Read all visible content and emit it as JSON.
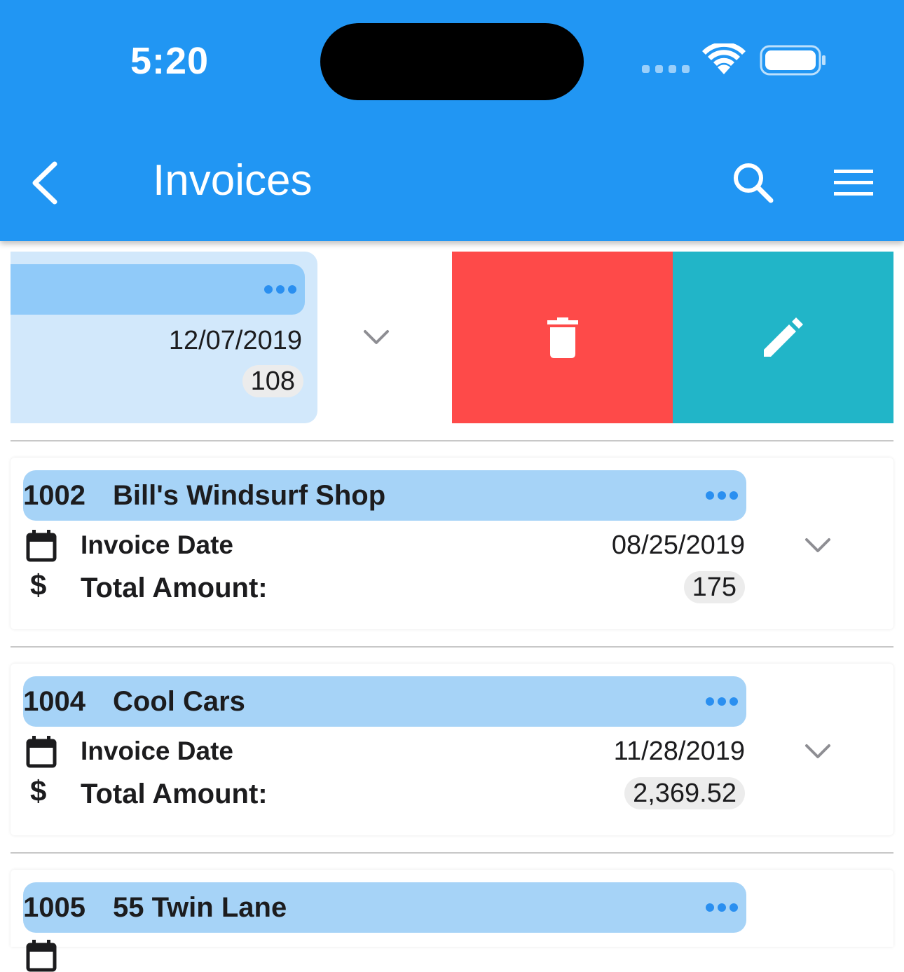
{
  "status_bar": {
    "time": "5:20"
  },
  "header": {
    "title": "Invoices"
  },
  "colors": {
    "app_bar": "#2196f3",
    "card_header": "#a6d3f7",
    "delete_action": "#fe4a49",
    "edit_action": "#21b5c8"
  },
  "swiped_item": {
    "date": "12/07/2019",
    "amount": "108"
  },
  "invoices": [
    {
      "number": "1002",
      "customer": "Bill's Windsurf Shop",
      "date_label": "Invoice Date",
      "date": "08/25/2019",
      "total_label": "Total Amount:",
      "total": "175"
    },
    {
      "number": "1004",
      "customer": "Cool Cars",
      "date_label": "Invoice Date",
      "date": "11/28/2019",
      "total_label": "Total Amount:",
      "total": "2,369.52"
    },
    {
      "number": "1005",
      "customer": "55 Twin Lane"
    }
  ],
  "icons": {
    "back": "chevron-left-icon",
    "search": "search-icon",
    "menu": "hamburger-menu-icon",
    "delete": "trash-icon",
    "edit": "pencil-icon",
    "more": "more-horizontal-icon",
    "expand": "chevron-down-icon",
    "calendar": "calendar-icon",
    "currency": "dollar-icon"
  }
}
